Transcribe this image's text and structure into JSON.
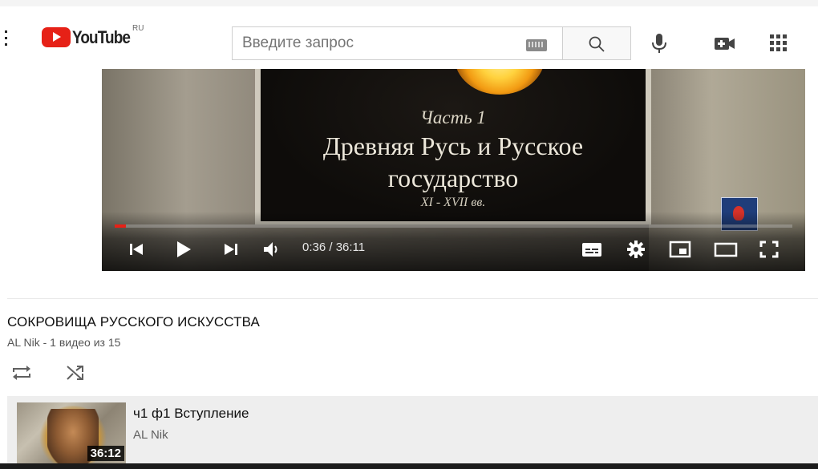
{
  "header": {
    "logo_text": "YouTube",
    "country": "RU",
    "search_placeholder": "Введите запрос",
    "icons": [
      "menu-dots-icon",
      "youtube-logo",
      "keyboard-icon",
      "search-icon",
      "microphone-icon",
      "create-video-icon",
      "apps-grid-icon"
    ]
  },
  "player": {
    "slide_part": "Часть 1",
    "slide_title_line1": "Древняя Русь и Русское",
    "slide_title_line2": "государство",
    "slide_years": "XI - XVII вв.",
    "time_display": "0:36 / 36:11",
    "progress_fraction": 0.0166,
    "accent_color": "#e62117",
    "controls": [
      "previous-icon",
      "play-icon",
      "next-icon",
      "volume-icon",
      "subtitles-icon",
      "settings-icon",
      "miniplayer-icon",
      "theater-mode-icon",
      "fullscreen-icon"
    ]
  },
  "playlist": {
    "title": "СОКРОВИЩА РУССКОГО ИСКУССТВА",
    "subtitle": "AL Nik - 1 видео из 15",
    "items": [
      {
        "title": "ч1 ф1 Вступление",
        "author": "AL Nik",
        "duration": "36:12"
      }
    ]
  }
}
